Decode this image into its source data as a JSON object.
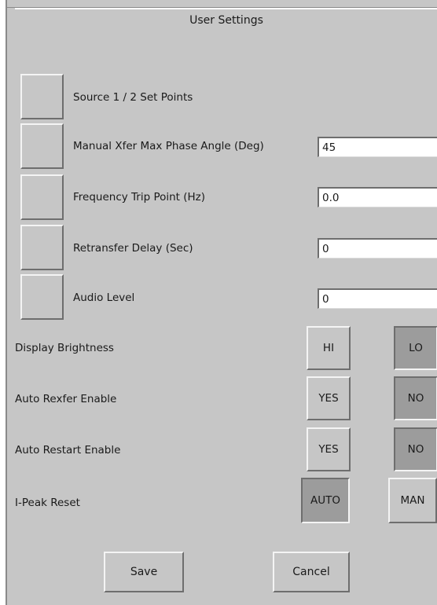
{
  "dialog": {
    "title": "User Settings"
  },
  "settings": [
    {
      "label": "Source 1 / 2 Set Points"
    },
    {
      "label": "Manual Xfer Max Phase Angle (Deg)",
      "value": "45"
    },
    {
      "label": "Frequency Trip Point (Hz)",
      "value": "0.0"
    },
    {
      "label": "Retransfer Delay (Sec)",
      "value": "0"
    },
    {
      "label": "Audio Level",
      "value": "0"
    }
  ],
  "toggles": [
    {
      "label": "Display Brightness",
      "option_a": "HI",
      "option_b": "LO",
      "selected": "LO"
    },
    {
      "label": "Auto Rexfer Enable",
      "option_a": "YES",
      "option_b": "NO",
      "selected": "NO"
    },
    {
      "label": "Auto Restart Enable",
      "option_a": "YES",
      "option_b": "NO",
      "selected": "NO"
    },
    {
      "label": "I-Peak Reset",
      "option_a": "AUTO",
      "option_b": "MAN",
      "selected": "AUTO"
    }
  ],
  "actions": {
    "save": "Save",
    "cancel": "Cancel"
  }
}
